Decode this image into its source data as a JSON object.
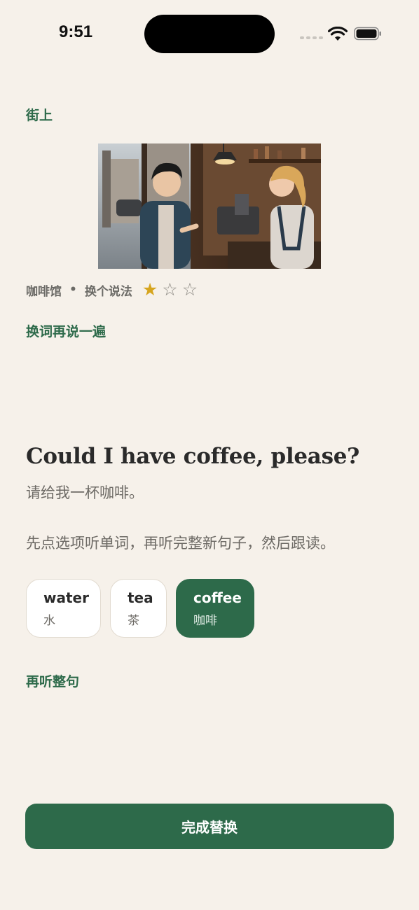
{
  "status_bar": {
    "time": "9:51"
  },
  "location": "街上",
  "scene_meta": {
    "place": "咖啡馆",
    "separator": "•",
    "mode": "换个说法",
    "rating": 1,
    "rating_max": 3
  },
  "retry_label": "换词再说一遍",
  "sentence": {
    "english": "Could I have coffee, please?",
    "chinese": "请给我一杯咖啡。"
  },
  "instruction": "先点选项听单词，再听完整新句子，然后跟读。",
  "options": [
    {
      "en": "water",
      "zh": "水",
      "selected": false
    },
    {
      "en": "tea",
      "zh": "茶",
      "selected": false
    },
    {
      "en": "coffee",
      "zh": "咖啡",
      "selected": true
    }
  ],
  "relisten_label": "再听整句",
  "primary_button": "完成替换",
  "colors": {
    "accent": "#2d6a4a",
    "background": "#f6f1ea",
    "star": "#d6a51e"
  },
  "icons": {
    "signal": "cellular-signal-icon",
    "wifi": "wifi-icon",
    "battery": "battery-icon"
  }
}
